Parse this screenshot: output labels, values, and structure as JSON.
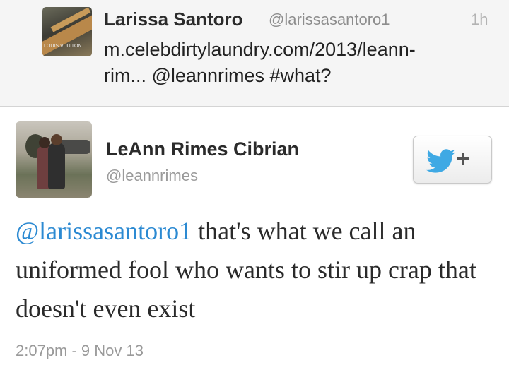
{
  "reply_tweet": {
    "author_name": "Larissa Santoro",
    "author_handle": "@larissasantoro1",
    "time": "1h",
    "text_line1": "m.celebdirtylaundry.com/2013/leann-",
    "text_line2": "rim... @leannrimes #what?",
    "avatar_icon": "handbag-photo-avatar",
    "avatar_text": "LOUIS VUITTON"
  },
  "main_tweet": {
    "author_name": "LeAnn Rimes Cibrian",
    "author_handle": "@leannrimes",
    "avatar_icon": "couple-photo-avatar",
    "follow_button": {
      "icon": "twitter-bird-icon",
      "plus": "+"
    },
    "mention": "@larissasantoro1",
    "text_rest": " that's what we call an uniformed fool who wants to stir up crap that doesn't even exist",
    "timestamp": "2:07pm - 9 Nov 13"
  },
  "colors": {
    "link": "#2c8ad2",
    "bird": "#3fa9e4",
    "top_background": "#f5f5f5"
  }
}
